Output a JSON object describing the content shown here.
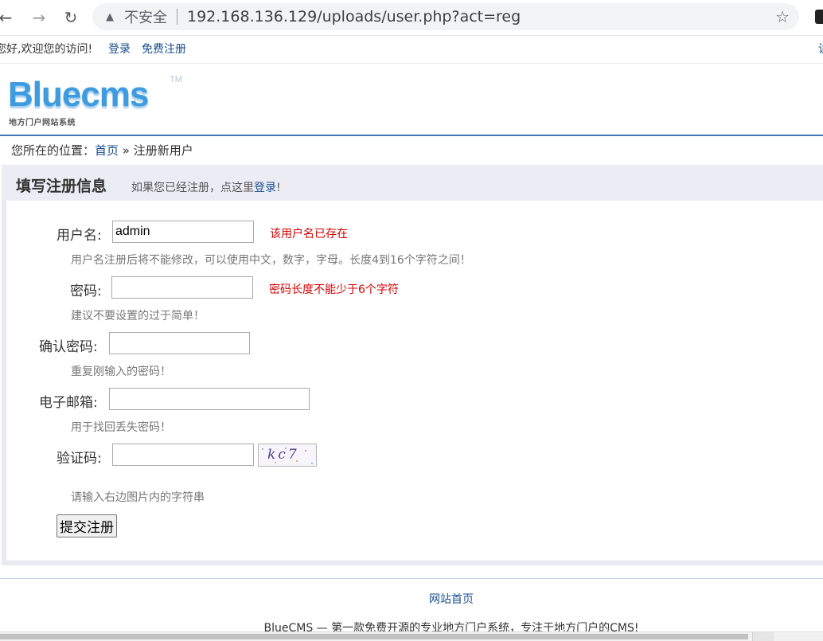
{
  "browser": {
    "security_label": "不安全",
    "url": "192.168.136.129/uploads/user.php?act=reg"
  },
  "topbar": {
    "welcome": "您好,欢迎您的访问!",
    "login": "登录",
    "register": "免费注册",
    "right_partial": "读"
  },
  "logo": {
    "word": "Bluecms",
    "tm": "TM",
    "tagline": "地方门户网站系统"
  },
  "breadcrumb": {
    "prefix": "您所在的位置：",
    "home": "首页",
    "separator": " » ",
    "current": "注册新用户"
  },
  "panel": {
    "title": "填写注册信息",
    "tip_prefix": "如果您已经注册，点这里",
    "tip_link": "登录",
    "tip_suffix": "!"
  },
  "form": {
    "username": {
      "label": "用户名:",
      "value": "admin",
      "error": "该用户名已存在",
      "hint": "用户名注册后将不能修改，可以使用中文，数字，字母。长度4到16个字符之间！"
    },
    "password": {
      "label": "密码:",
      "value": "",
      "error": "密码长度不能少于6个字符",
      "hint": "建议不要设置的过于简单！"
    },
    "confirm": {
      "label": "确认密码:",
      "value": "",
      "hint": "重复刚输入的密码！"
    },
    "email": {
      "label": "电子邮箱:",
      "value": "",
      "hint": "用于找回丢失密码！"
    },
    "captcha": {
      "label": "验证码:",
      "value": "",
      "image_text": "kc7",
      "hint": "请输入右边图片内的字符串"
    },
    "submit": "提交注册"
  },
  "footer": {
    "link": "网站首页",
    "text": "BlueCMS — 第一款免费开源的专业地方门户系统，专注于地方门户的CMS!"
  },
  "colors": {
    "link": "#1a4f8b",
    "error": "#d40000",
    "hint": "#777777",
    "logo_blue": "#3f9be0",
    "rule_blue": "#3d78b7",
    "panel_bg": "#e9e9f2"
  },
  "icons": [
    "back-arrow-icon",
    "forward-arrow-icon",
    "reload-icon",
    "warning-triangle-icon",
    "bookmark-star-icon"
  ]
}
